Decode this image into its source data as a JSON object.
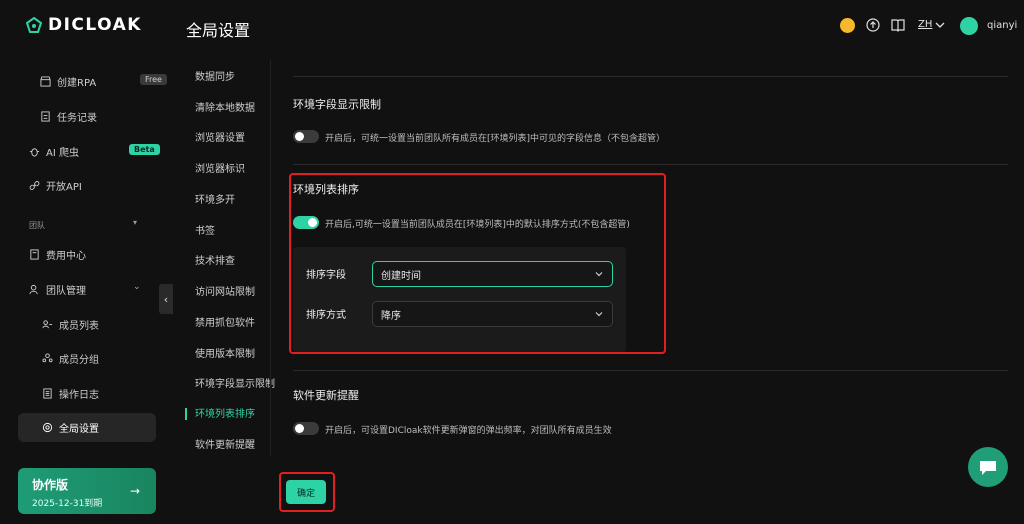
{
  "app": {
    "logo_text": "DICLOAK",
    "page_title": "全局设置"
  },
  "header": {
    "lang": "ZH",
    "username": "qianyi",
    "icons": [
      "sun-icon",
      "upload-icon",
      "book-icon",
      "chevron-down-icon",
      "avatar"
    ]
  },
  "sidebar": {
    "items": [
      {
        "label": "创建RPA",
        "badge": "Free",
        "icon": "store-icon"
      },
      {
        "label": "任务记录",
        "icon": "document-icon"
      },
      {
        "label": "AI 爬虫",
        "badge": "Beta",
        "icon": "bug-icon"
      },
      {
        "label": "开放API",
        "icon": "link-icon"
      },
      {
        "label": "费用中心",
        "icon": "bill-icon"
      },
      {
        "label": "团队管理",
        "icon": "users-icon"
      },
      {
        "label": "成员列表",
        "icon": "member-list-icon"
      },
      {
        "label": "成员分组",
        "icon": "group-icon"
      },
      {
        "label": "操作日志",
        "icon": "log-icon"
      },
      {
        "label": "全局设置",
        "icon": "settings-icon"
      }
    ],
    "section_label": "团队",
    "promo": {
      "title": "协作版",
      "expiry": "2025-12-31到期",
      "arrow": "→"
    }
  },
  "subnav": {
    "items": [
      "数据同步",
      "清除本地数据",
      "浏览器设置",
      "浏览器标识",
      "环境多开",
      "书签",
      "技术排查",
      "访问网站限制",
      "禁用抓包软件",
      "使用版本限制",
      "环境字段显示限制",
      "环境列表排序",
      "软件更新提醒"
    ],
    "active_index": 11
  },
  "sections": {
    "field_display": {
      "title": "环境字段显示限制",
      "enabled": false,
      "desc": "开启后，可统一设置当前团队所有成员在[环境列表]中可见的字段信息（不包含超管）"
    },
    "list_sort": {
      "title": "环境列表排序",
      "enabled": true,
      "desc": "开启后,可统一设置当前团队成员在[环境列表]中的默认排序方式(不包含超管)",
      "sort_field_label": "排序字段",
      "sort_field_value": "创建时间",
      "sort_order_label": "排序方式",
      "sort_order_value": "降序"
    },
    "update_reminder": {
      "title": "软件更新提醒",
      "enabled": false,
      "desc": "开启后，可设置DICloak软件更新弹窗的弹出频率，对团队所有成员生效"
    }
  },
  "actions": {
    "confirm_label": "确定"
  },
  "colors": {
    "accent": "#2ed3a5",
    "highlight": "#e02020",
    "bg": "#111111"
  }
}
